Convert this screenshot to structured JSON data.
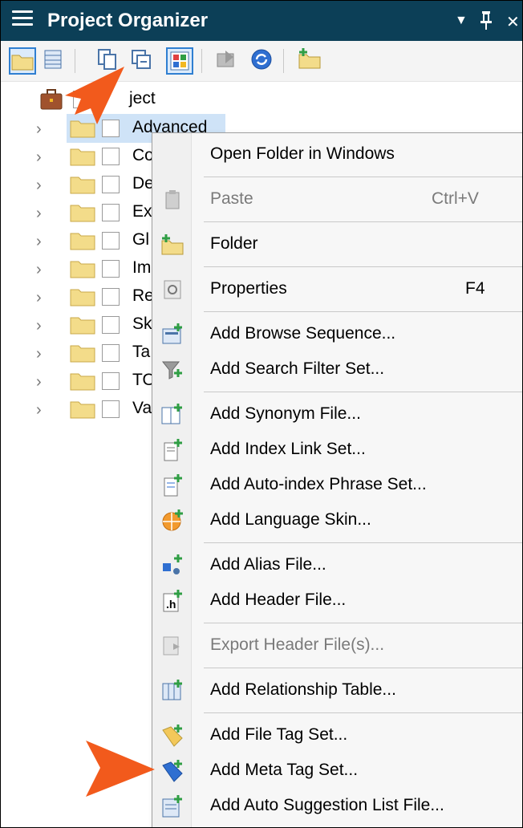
{
  "window": {
    "title": "Project Organizer",
    "controls": {
      "dropdown": "▼",
      "pin": "🖈",
      "close": "✕"
    }
  },
  "toolbar": {
    "buttons": [
      {
        "icon": "folder-icon",
        "selected": true
      },
      {
        "icon": "grid-view-icon",
        "selected": false
      },
      {
        "icon": "copy-icon",
        "selected": false
      },
      {
        "icon": "collapse-all-icon",
        "selected": false
      },
      {
        "icon": "color-tiles-icon",
        "selected": true
      },
      {
        "icon": "export-icon",
        "selected": false
      },
      {
        "icon": "sync-icon",
        "selected": false
      },
      {
        "icon": "new-folder-icon",
        "selected": false
      }
    ]
  },
  "tree": {
    "root_label": "Project",
    "visible_root_label": "ject",
    "items": [
      {
        "label": "Advanced",
        "selected": true
      },
      {
        "label": "Co"
      },
      {
        "label": "De"
      },
      {
        "label": "Ex"
      },
      {
        "label": "Gl"
      },
      {
        "label": "Im"
      },
      {
        "label": "Re"
      },
      {
        "label": "Sk"
      },
      {
        "label": "Ta"
      },
      {
        "label": "TO"
      },
      {
        "label": "Va"
      }
    ]
  },
  "context_menu": {
    "items": [
      {
        "label": "Open Folder in Windows",
        "shortcut": "",
        "icon": "none",
        "disabled": false
      },
      {
        "label": "Paste",
        "shortcut": "Ctrl+V",
        "icon": "paste-icon",
        "disabled": true
      },
      {
        "label": "Folder",
        "shortcut": "",
        "icon": "new-folder-icon",
        "disabled": false
      },
      {
        "label": "Properties",
        "shortcut": "F4",
        "icon": "properties-icon",
        "disabled": false
      },
      {
        "label": "Add Browse Sequence...",
        "shortcut": "",
        "icon": "browse-sequence-icon",
        "disabled": false
      },
      {
        "label": "Add Search Filter Set...",
        "shortcut": "",
        "icon": "search-filter-icon",
        "disabled": false
      },
      {
        "label": "Add Synonym File...",
        "shortcut": "",
        "icon": "synonym-file-icon",
        "disabled": false
      },
      {
        "label": "Add Index Link Set...",
        "shortcut": "",
        "icon": "index-link-icon",
        "disabled": false
      },
      {
        "label": "Add Auto-index Phrase Set...",
        "shortcut": "",
        "icon": "auto-index-icon",
        "disabled": false
      },
      {
        "label": "Add Language Skin...",
        "shortcut": "",
        "icon": "language-skin-icon",
        "disabled": false
      },
      {
        "label": "Add Alias File...",
        "shortcut": "",
        "icon": "alias-file-icon",
        "disabled": false
      },
      {
        "label": "Add Header File...",
        "shortcut": "",
        "icon": "header-file-icon",
        "disabled": false
      },
      {
        "label": "Export Header File(s)...",
        "shortcut": "",
        "icon": "export-header-icon",
        "disabled": true
      },
      {
        "label": "Add Relationship Table...",
        "shortcut": "",
        "icon": "relationship-table-icon",
        "disabled": false
      },
      {
        "label": "Add File Tag Set...",
        "shortcut": "",
        "icon": "file-tag-icon",
        "disabled": false
      },
      {
        "label": "Add Meta Tag Set...",
        "shortcut": "",
        "icon": "meta-tag-icon",
        "disabled": false
      },
      {
        "label": "Add Auto Suggestion List File...",
        "shortcut": "",
        "icon": "auto-suggestion-icon",
        "disabled": false
      }
    ]
  },
  "colors": {
    "titlebar": "#0c3f57",
    "selection": "#cfe3f7",
    "callout_arrow": "#f25a1c",
    "folder": "#f3dc8a"
  }
}
